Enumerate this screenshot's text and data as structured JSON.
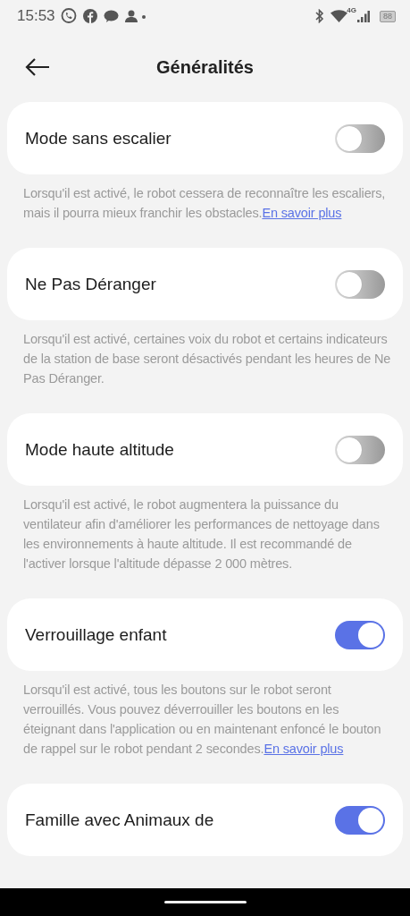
{
  "status_bar": {
    "time": "15:53",
    "network": "4G",
    "battery": "88"
  },
  "header": {
    "title": "Généralités"
  },
  "settings": [
    {
      "label": "Mode sans escalier",
      "on": false,
      "description": "Lorsqu'il est activé, le robot cessera de reconnaître les escaliers, mais il pourra mieux franchir les obstacles.",
      "link": "En savoir plus"
    },
    {
      "label": "Ne Pas Déranger",
      "on": false,
      "description": "Lorsqu'il est activé, certaines voix du robot et certains indicateurs de la station de base seront désactivés pendant les heures de Ne Pas Déranger."
    },
    {
      "label": "Mode haute altitude",
      "on": false,
      "description": "Lorsqu'il est activé, le robot augmentera la puissance du ventilateur afin d'améliorer les performances de nettoyage dans les environnements à haute altitude. Il est recommandé de l'activer lorsque l'altitude dépasse 2 000 mètres."
    },
    {
      "label": "Verrouillage enfant",
      "on": true,
      "description": "Lorsqu'il est activé, tous les boutons sur le robot seront verrouillés. Vous pouvez déverrouiller les boutons en les éteignant dans l'application ou en maintenant enfoncé le bouton de rappel sur le robot pendant 2 secondes.",
      "link": "En savoir plus"
    },
    {
      "label": "Famille avec Animaux de",
      "on": true
    }
  ]
}
